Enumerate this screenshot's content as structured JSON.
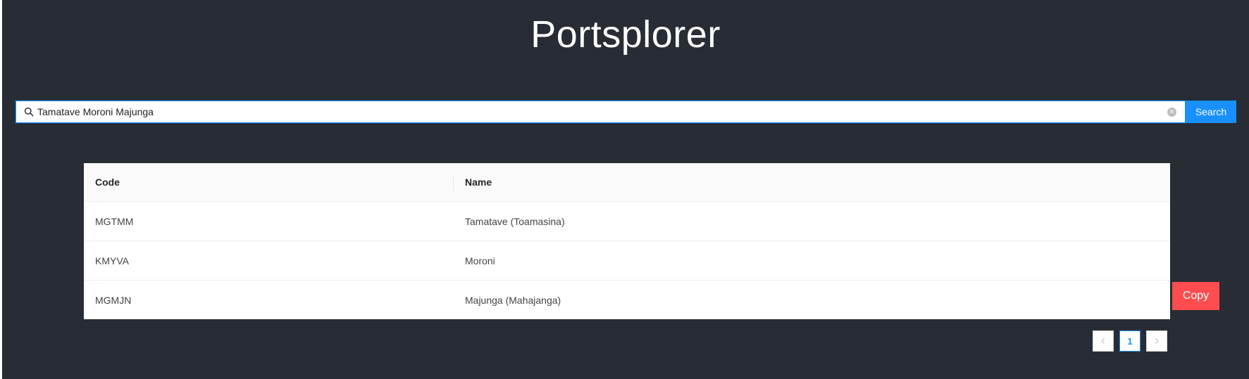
{
  "app": {
    "title": "Portsplorer"
  },
  "search": {
    "value": "Tamatave Moroni Majunga",
    "placeholder": "",
    "button_label": "Search"
  },
  "table": {
    "columns": [
      "Code",
      "Name"
    ],
    "rows": [
      {
        "code": "MGTMM",
        "name": "Tamatave (Toamasina)"
      },
      {
        "code": "KMYVA",
        "name": "Moroni"
      },
      {
        "code": "MGMJN",
        "name": "Majunga (Mahajanga)"
      }
    ]
  },
  "copy": {
    "label": "Copy"
  },
  "pagination": {
    "current_page": "1"
  },
  "colors": {
    "background": "#282c34",
    "primary": "#1890ff",
    "danger": "#ff4d4f"
  },
  "icons": {
    "search": "search-icon",
    "clear": "clear-icon",
    "prev": "chevron-left-icon",
    "next": "chevron-right-icon"
  }
}
